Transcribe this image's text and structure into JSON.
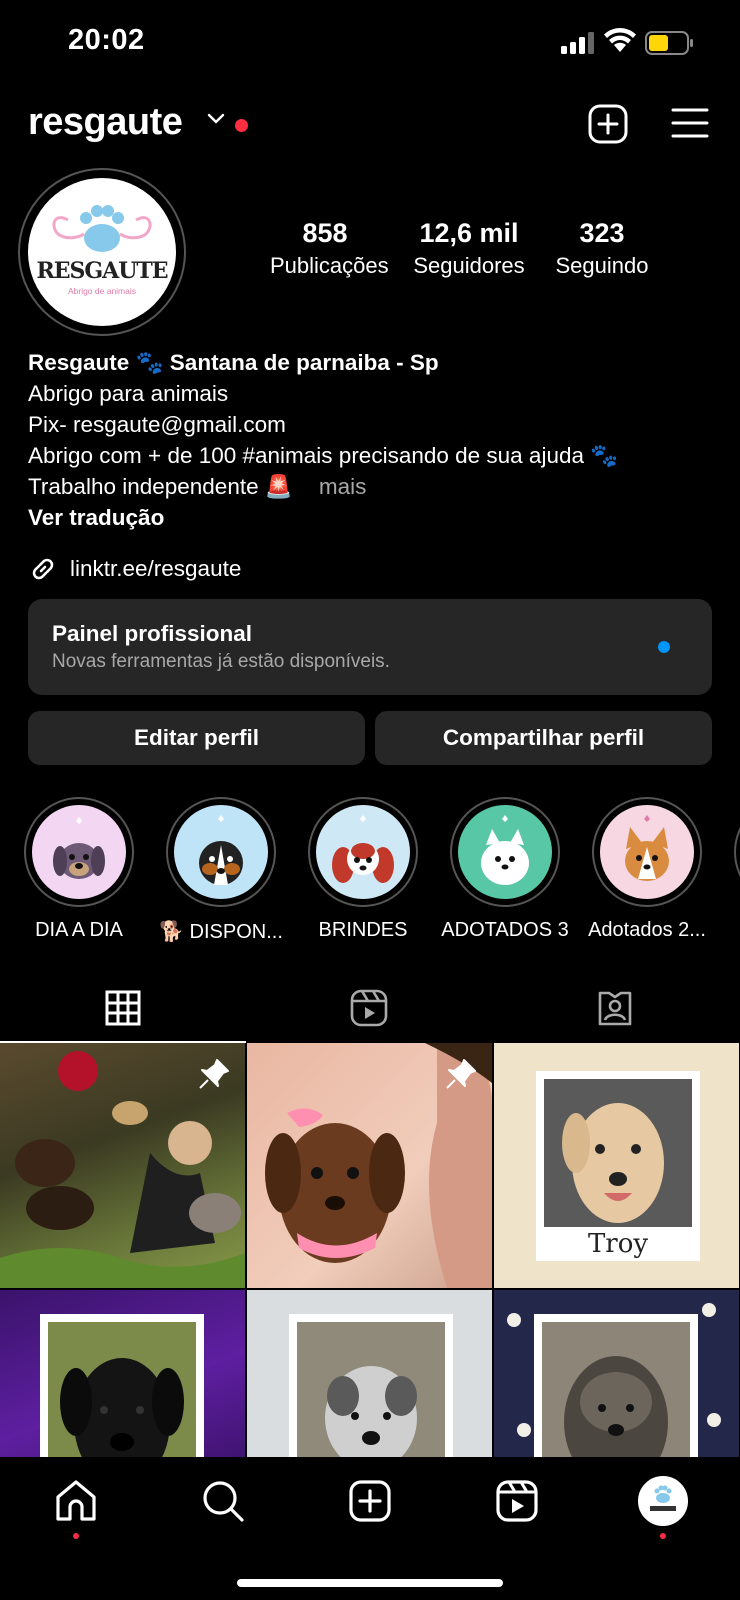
{
  "status_bar": {
    "time": "20:02"
  },
  "header": {
    "username": "resgaute"
  },
  "profile": {
    "avatar_title": "RESGAUTE",
    "avatar_sub": "Abrigo de animais",
    "stats": [
      {
        "value": "858",
        "label": "Publicações"
      },
      {
        "value": "12,6 mil",
        "label": "Seguidores"
      },
      {
        "value": "323",
        "label": "Seguindo"
      }
    ],
    "bio": {
      "name_line": "Resgaute 🐾 Santana de parnaiba - Sp",
      "line1": "Abrigo para animais",
      "line2": "Pix- resgaute@gmail.com",
      "line3": "Abrigo com + de 100 #animais precisando de sua ajuda 🐾",
      "line4": "Trabalho independente 🚨",
      "more": "mais",
      "translate": "Ver tradução"
    },
    "link": "linktr.ee/resgaute"
  },
  "panel": {
    "title": "Painel profissional",
    "subtitle": "Novas ferramentas já estão disponíveis."
  },
  "buttons": {
    "edit": "Editar perfil",
    "share": "Compartilhar perfil"
  },
  "highlights": [
    {
      "label": "DIA A DIA",
      "bg": "#f3d6f2"
    },
    {
      "label": "🐕 DISPON...",
      "bg": "#bfe3f7"
    },
    {
      "label": "BRINDES",
      "bg": "#cfe8f6"
    },
    {
      "label": "ADOTADOS 3",
      "bg": "#58c7a5"
    },
    {
      "label": "Adotados 2...",
      "bg": "#f7d8e2"
    }
  ],
  "grid": {
    "caption_troy": "Troy"
  },
  "colors": {
    "accent_blue": "#0095f6",
    "notification_red": "#ff2d41",
    "panel_bg": "#262626"
  }
}
